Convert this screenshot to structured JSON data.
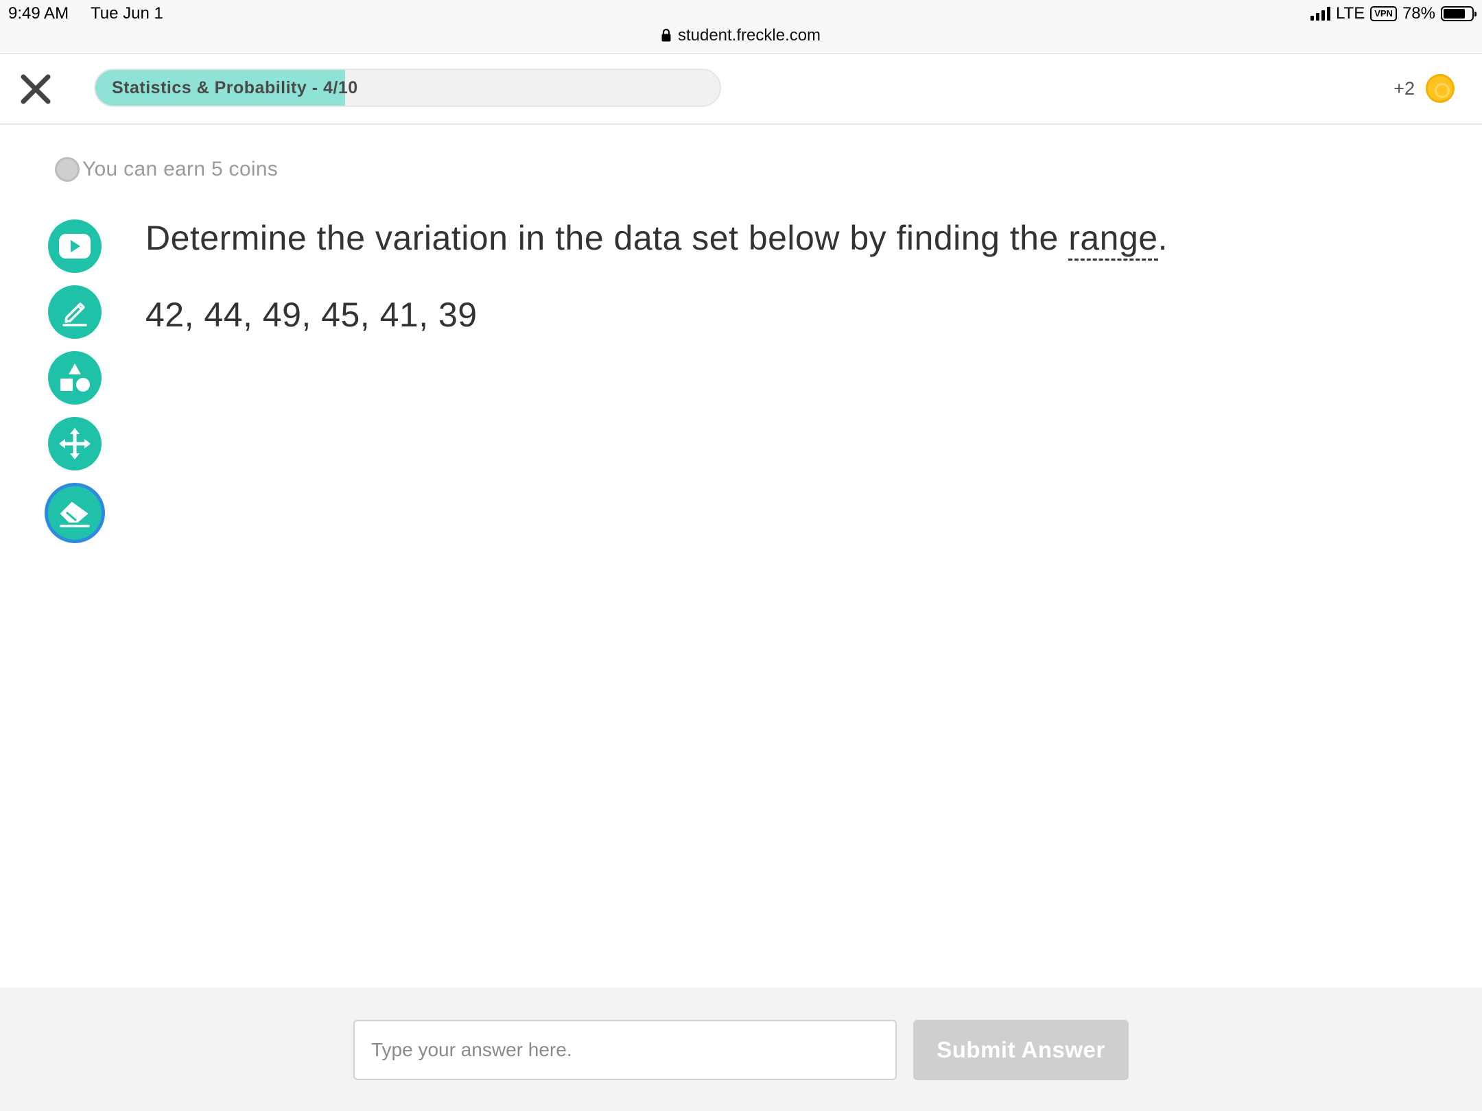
{
  "status_bar": {
    "time": "9:49 AM",
    "date": "Tue Jun 1",
    "url": "student.freckle.com",
    "network": "LTE",
    "vpn": "VPN",
    "battery": "78%",
    "battery_level": 0.78
  },
  "header": {
    "progress_label": "Statistics & Probability - 4/10",
    "progress_fraction": 0.4,
    "coins_earned": "+2"
  },
  "earn": {
    "text": "You can earn 5 coins"
  },
  "tools": [
    {
      "name": "video-icon"
    },
    {
      "name": "pencil-icon"
    },
    {
      "name": "shapes-icon"
    },
    {
      "name": "move-icon"
    },
    {
      "name": "eraser-icon",
      "active": true
    }
  ],
  "question": {
    "text_before": "Determine the variation in the data set below by finding the ",
    "term": "range",
    "text_after": ".",
    "data": "42, 44, 49, 45, 41, 39"
  },
  "answer": {
    "placeholder": "Type your answer here.",
    "value": "",
    "submit_label": "Submit Answer"
  },
  "colors": {
    "accent": "#1fc2a9",
    "progress_fill": "#8fe3d6",
    "active_ring": "#2d8ae0",
    "coin": "#ffc21f"
  }
}
